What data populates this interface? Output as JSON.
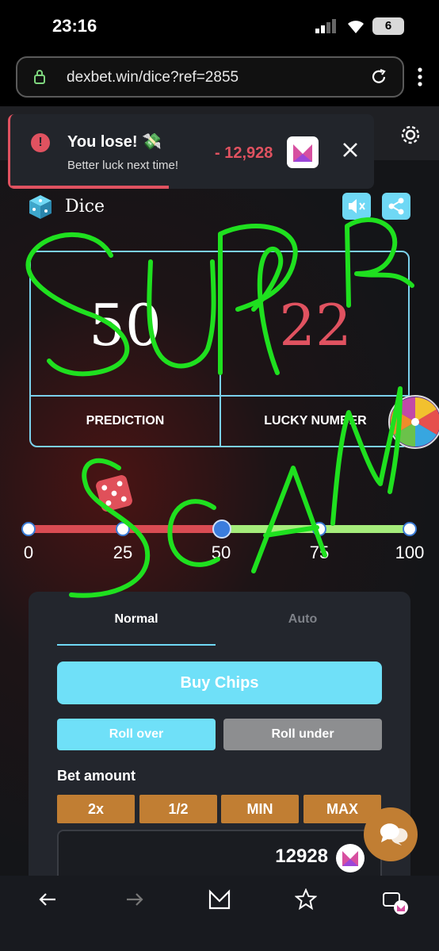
{
  "status": {
    "time": "23:16",
    "battery": "6"
  },
  "browser": {
    "url": "dexbet.win/dice?ref=2855"
  },
  "toast": {
    "title": "You lose! 💸",
    "subtitle": "Better luck next time!",
    "amount": "- 12,928"
  },
  "game": {
    "title": "Dice",
    "prediction": "50",
    "lucky_number": "22",
    "prediction_label": "PREDICTION",
    "lucky_label": "LUCKY NUMBER"
  },
  "slider": {
    "ticks": [
      "0",
      "25",
      "50",
      "75",
      "100"
    ],
    "value": 50
  },
  "panel": {
    "tab_normal": "Normal",
    "tab_auto": "Auto",
    "buy_chips": "Buy Chips",
    "roll_over": "Roll over",
    "roll_under": "Roll under",
    "bet_label": "Bet amount",
    "quick": [
      "2x",
      "1/2",
      "MIN",
      "MAX"
    ],
    "bet_value": "12928"
  },
  "overlay": {
    "handwriting": "SUPER SCAM",
    "color": "#1fe01f"
  },
  "colors": {
    "accent": "#6fe0f8",
    "lose": "#e05260",
    "gold": "#c17e33",
    "win_track": "#a5ec7b"
  }
}
